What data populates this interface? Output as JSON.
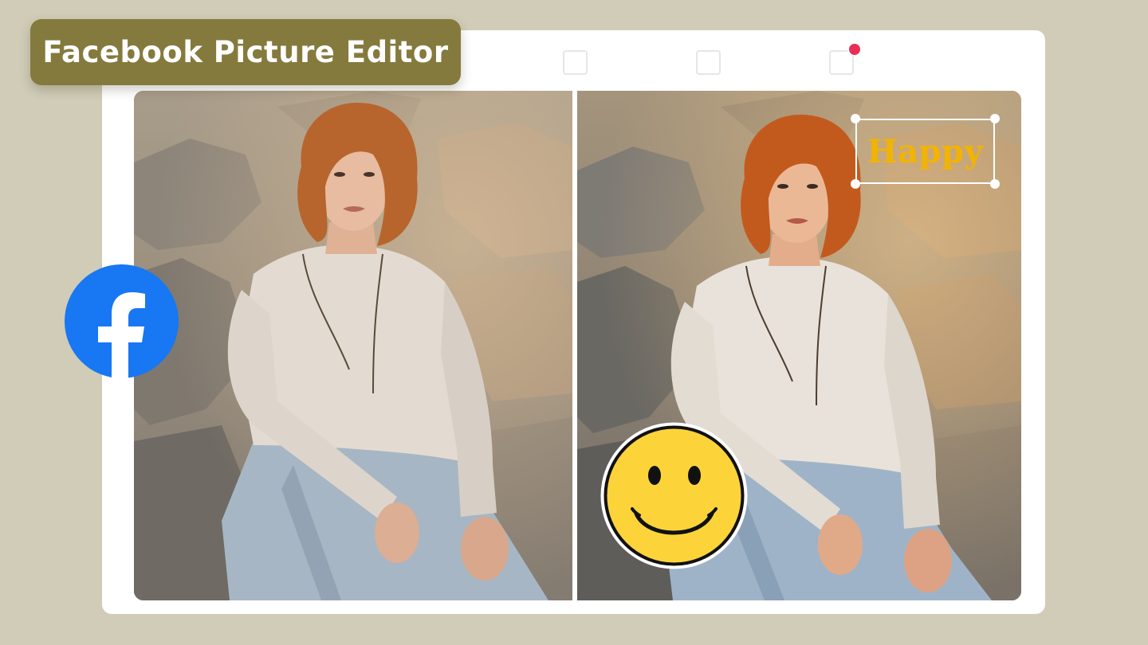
{
  "title": "Facebook Picture Editor",
  "sticker_text": "Happy",
  "icons": {
    "brand": "facebook-logo-icon",
    "sticker": "smiley-face-icon"
  },
  "colors": {
    "background": "#d0ccb7",
    "title_pill": "#857a3d",
    "facebook_blue": "#1877f2",
    "notification": "#ea2e55",
    "text_sticker": "#f2b400",
    "smiley_fill": "#fcd43a"
  },
  "panels": [
    "original",
    "edited"
  ]
}
